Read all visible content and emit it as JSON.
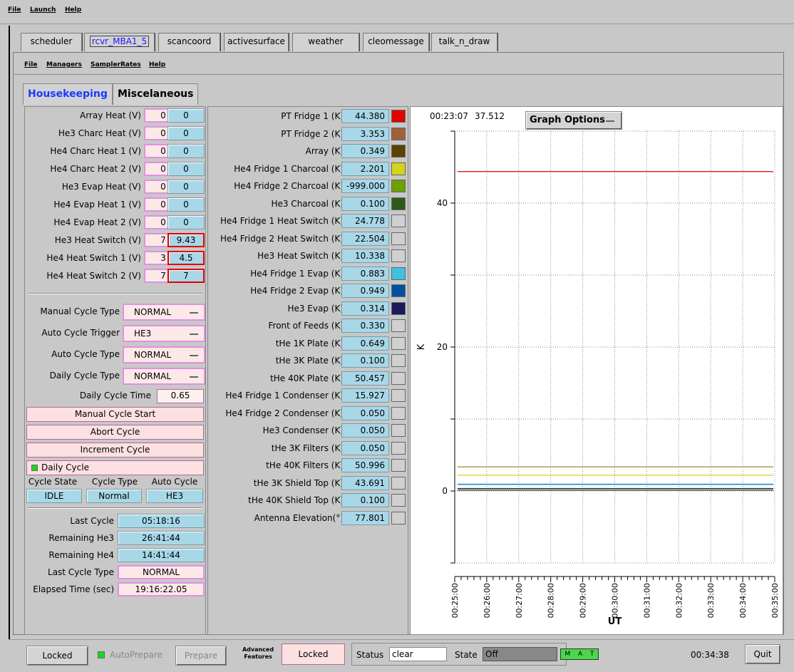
{
  "top_menu": [
    "File",
    "Launch",
    "Help"
  ],
  "tabs": [
    "scheduler",
    "rcvr_MBA1_5",
    "scancoord",
    "activesurface",
    "weather",
    "cleomessage",
    "talk_n_draw"
  ],
  "sub_menu": [
    "File",
    "Managers",
    "SamplerRates",
    "Help"
  ],
  "inner_tabs": [
    "Housekeeping",
    "Miscelaneous"
  ],
  "heaters": [
    {
      "label": "Array Heat (V)",
      "set": "0",
      "val": "0"
    },
    {
      "label": "He3 Charc Heat (V)",
      "set": "0",
      "val": "0"
    },
    {
      "label": "He4 Charc Heat 1 (V)",
      "set": "0",
      "val": "0"
    },
    {
      "label": "He4 Charc Heat 2 (V)",
      "set": "0",
      "val": "0"
    },
    {
      "label": "He3 Evap Heat (V)",
      "set": "0",
      "val": "0"
    },
    {
      "label": "He4 Evap Heat 1 (V)",
      "set": "0",
      "val": "0"
    },
    {
      "label": "He4 Evap Heat 2 (V)",
      "set": "0",
      "val": "0"
    },
    {
      "label": "He3 Heat Switch (V)",
      "set": "7",
      "val": "9.43"
    },
    {
      "label": "He4 Heat Switch 1 (V)",
      "set": "3",
      "val": "4.5"
    },
    {
      "label": "He4 Heat Switch 2 (V)",
      "set": "7",
      "val": "7"
    }
  ],
  "cycle_selects": [
    {
      "label": "Manual Cycle Type",
      "value": "NORMAL"
    },
    {
      "label": "Auto Cycle Trigger",
      "value": "HE3"
    },
    {
      "label": "Auto Cycle Type",
      "value": "NORMAL"
    },
    {
      "label": "Daily Cycle Type",
      "value": "NORMAL"
    }
  ],
  "daily_cycle_time": {
    "label": "Daily Cycle Time",
    "value": "0.65"
  },
  "buttons": {
    "manual_start": "Manual Cycle Start",
    "abort": "Abort Cycle",
    "increment": "Increment Cycle",
    "daily": "Daily Cycle"
  },
  "state_headers": [
    "Cycle State",
    "Cycle Type",
    "Auto Cycle"
  ],
  "state_values": [
    "IDLE",
    "Normal",
    "HE3"
  ],
  "last_info": [
    {
      "label": "Last Cycle",
      "value": "05:18:16"
    },
    {
      "label": "Remaining He3",
      "value": "26:41:44"
    },
    {
      "label": "Remaining He4",
      "value": "14:41:44"
    },
    {
      "label": "Last Cycle Type",
      "value": "NORMAL"
    },
    {
      "label": "Elapsed Time (sec)",
      "value": "19:16:22.05"
    }
  ],
  "temps": [
    {
      "label": "PT Fridge 1 (K)",
      "value": "44.380",
      "color": "#e00000"
    },
    {
      "label": "PT Fridge 2 (K)",
      "value": "3.353",
      "color": "#a0603a"
    },
    {
      "label": "Array (K)",
      "value": "0.349",
      "color": "#5a4200"
    },
    {
      "label": "He4 Fridge 1 Charcoal (K)",
      "value": "2.201",
      "color": "#d4d41a"
    },
    {
      "label": "He4 Fridge 2 Charcoal (K)",
      "value": "-999.000",
      "color": "#6aa000"
    },
    {
      "label": "He3 Charcoal (K)",
      "value": "0.100",
      "color": "#2a5a1a"
    },
    {
      "label": "He4 Fridge 1 Heat Switch (K)",
      "value": "24.778",
      "color": "#d0d0d0"
    },
    {
      "label": "He4 Fridge 2 Heat Switch (K)",
      "value": "22.504",
      "color": "#d0d0d0"
    },
    {
      "label": "He3 Heat Switch (K)",
      "value": "10.338",
      "color": "#d0d0d0"
    },
    {
      "label": "He4 Fridge 1 Evap (K)",
      "value": "0.883",
      "color": "#40c0e0"
    },
    {
      "label": "He4 Fridge 2 Evap (K)",
      "value": "0.949",
      "color": "#0050a0"
    },
    {
      "label": "He3 Evap (K)",
      "value": "0.314",
      "color": "#1a1a5a"
    },
    {
      "label": "Front of Feeds (K)",
      "value": "0.330",
      "color": "#d0d0d0"
    },
    {
      "label": "tHe 1K Plate (K)",
      "value": "0.649",
      "color": "#d0d0d0"
    },
    {
      "label": "tHe 3K Plate (K)",
      "value": "0.100",
      "color": "#d0d0d0"
    },
    {
      "label": "tHe 40K Plate (K)",
      "value": "50.457",
      "color": "#d0d0d0"
    },
    {
      "label": "He4 Fridge 1 Condenser (K)",
      "value": "15.927",
      "color": "#d0d0d0"
    },
    {
      "label": "He4 Fridge 2 Condenser (K)",
      "value": "0.050",
      "color": "#d0d0d0"
    },
    {
      "label": "He3 Condenser (K)",
      "value": "0.050",
      "color": "#d0d0d0"
    },
    {
      "label": "tHe 3K Filters (K)",
      "value": "0.050",
      "color": "#d0d0d0"
    },
    {
      "label": "tHe 40K Filters (K)",
      "value": "50.996",
      "color": "#d0d0d0"
    },
    {
      "label": "tHe 3K Shield Top (K)",
      "value": "43.691",
      "color": "#d0d0d0"
    },
    {
      "label": "tHe 40K Shield Top (K)",
      "value": "0.100",
      "color": "#d0d0d0"
    },
    {
      "label": "Antenna Elevation(°)",
      "value": "77.801",
      "color": "#d0d0d0"
    }
  ],
  "graph": {
    "cursor_time": "00:23:07",
    "cursor_value": "37.512",
    "options_label": "Graph Options",
    "ylabel": "K",
    "xlabel": "UT"
  },
  "chart_data": {
    "type": "line",
    "xlabel": "UT",
    "ylabel": "K",
    "ylim": [
      -10,
      50
    ],
    "yticks": [
      0,
      20,
      40
    ],
    "xticks": [
      "00:25:00",
      "00:26:00",
      "00:27:00",
      "00:28:00",
      "00:29:00",
      "00:30:00",
      "00:31:00",
      "00:32:00",
      "00:33:00",
      "00:34:00",
      "00:35:00"
    ],
    "series": [
      {
        "color": "#e00000",
        "values": [
          44.38,
          44.38
        ]
      },
      {
        "color": "#a0803a",
        "values": [
          3.353,
          3.353
        ]
      },
      {
        "color": "#d4d41a",
        "values": [
          2.201,
          2.201
        ]
      },
      {
        "color": "#0050a0",
        "values": [
          0.949,
          0.949
        ]
      },
      {
        "color": "#40c0e0",
        "values": [
          0.883,
          0.883
        ]
      },
      {
        "color": "#5a4200",
        "values": [
          0.349,
          0.349
        ]
      },
      {
        "color": "#1a1a5a",
        "values": [
          0.314,
          0.314
        ]
      },
      {
        "color": "#2a5a1a",
        "values": [
          0.1,
          0.1
        ]
      }
    ],
    "grid": true
  },
  "bottom": {
    "locked1": "Locked",
    "autoprepare": "AutoPrepare",
    "prepare": "Prepare",
    "advanced": "Advanced Features",
    "locked2": "Locked",
    "status_label": "Status",
    "status_value": "clear",
    "state_label": "State",
    "state_value": "Off",
    "mat": [
      "M",
      "A",
      "T"
    ],
    "time": "00:34:38",
    "quit": "Quit"
  }
}
